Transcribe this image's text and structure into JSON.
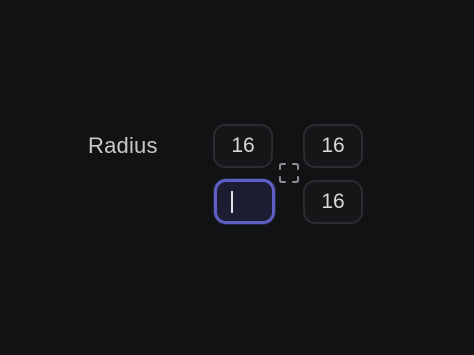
{
  "radius": {
    "label": "Radius",
    "top_left": "16",
    "top_right": "16",
    "bottom_left": "",
    "bottom_right": "16",
    "link_icon": "corners-link-icon"
  },
  "colors": {
    "background": "#111214",
    "focus_accent": "#5d5fc4",
    "field_border": "#2b2c30",
    "text": "#d6d6d9"
  }
}
